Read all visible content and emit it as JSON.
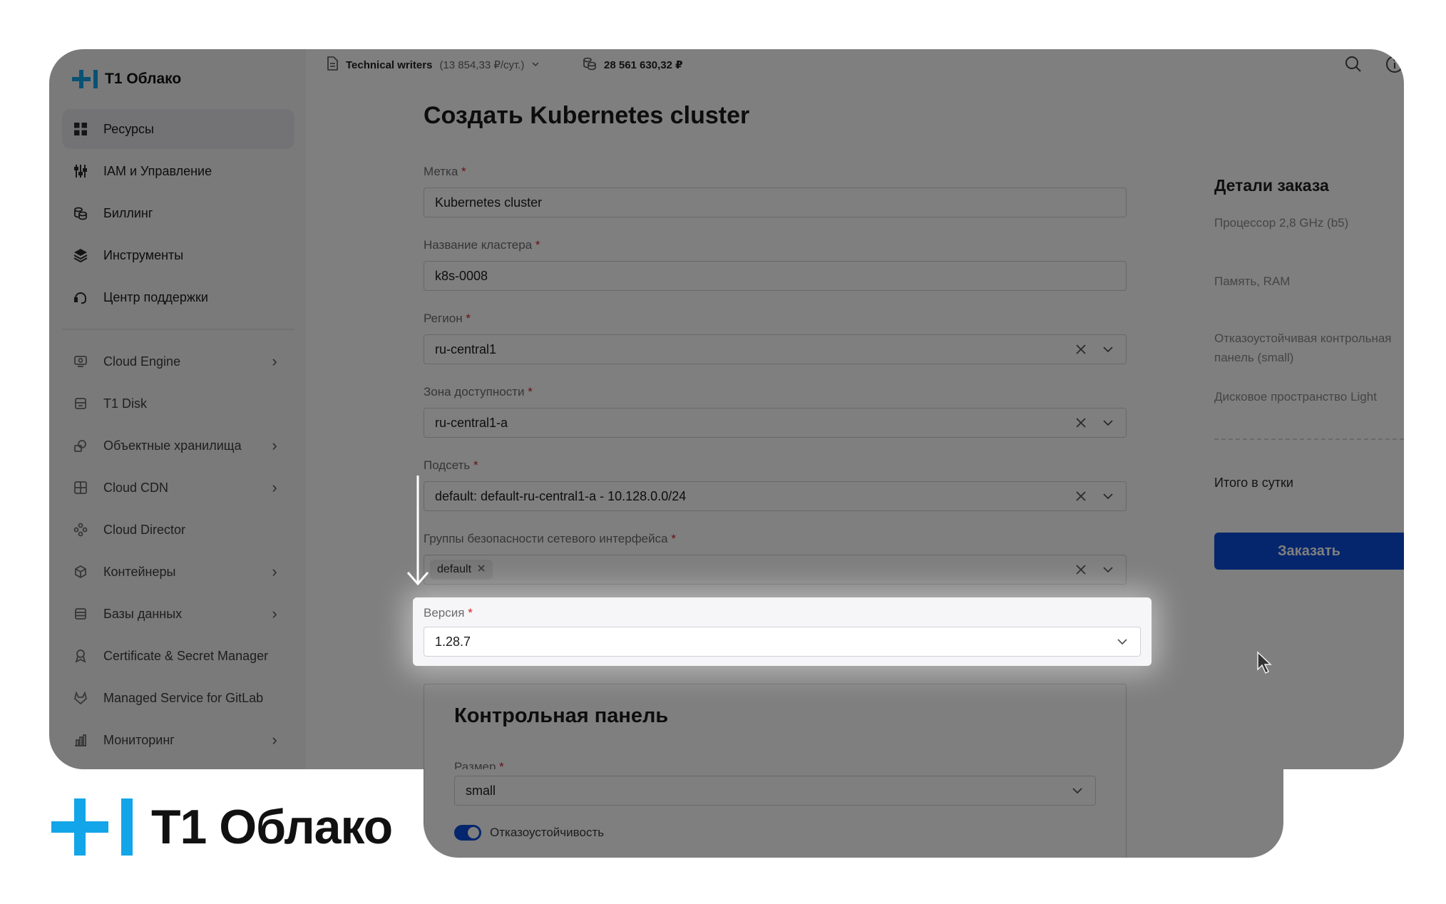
{
  "sidebar": {
    "logo_text": "T1 Облако",
    "items": [
      {
        "label": "Ресурсы",
        "icon": "grid-icon"
      },
      {
        "label": "IAM и Управление",
        "icon": "sliders-icon"
      },
      {
        "label": "Биллинг",
        "icon": "coins-icon"
      },
      {
        "label": "Инструменты",
        "icon": "layers-icon"
      },
      {
        "label": "Центр поддержки",
        "icon": "headset-icon"
      }
    ],
    "services": [
      {
        "label": "Cloud Engine",
        "icon": "monitor-icon",
        "chevron": true
      },
      {
        "label": "T1 Disk",
        "icon": "disk-icon",
        "chevron": false
      },
      {
        "label": "Объектные хранилища",
        "icon": "storage-icon",
        "chevron": true
      },
      {
        "label": "Cloud CDN",
        "icon": "cdn-icon",
        "chevron": true
      },
      {
        "label": "Cloud Director",
        "icon": "director-icon",
        "chevron": false
      },
      {
        "label": "Контейнеры",
        "icon": "container-icon",
        "chevron": true
      },
      {
        "label": "Базы данных",
        "icon": "database-icon",
        "chevron": true
      },
      {
        "label": "Certificate & Secret Manager",
        "icon": "certificate-icon",
        "chevron": false
      },
      {
        "label": "Managed Service for GitLab",
        "icon": "gitlab-icon",
        "chevron": false
      },
      {
        "label": "Мониторинг",
        "icon": "chart-icon",
        "chevron": true
      }
    ]
  },
  "topbar": {
    "project_name": "Technical writers",
    "project_rate": "(13 854,33 ₽/сут.)",
    "balance": "28 561 630,32 ₽"
  },
  "form": {
    "title": "Создать Kubernetes cluster",
    "label_field": {
      "label": "Метка",
      "value": "Kubernetes cluster"
    },
    "cluster_name": {
      "label": "Название кластера",
      "value": "k8s-0008"
    },
    "region": {
      "label": "Регион",
      "value": "ru-central1"
    },
    "zone": {
      "label": "Зона доступности",
      "value": "ru-central1-a"
    },
    "subnet": {
      "label": "Подсеть",
      "value": "default: default-ru-central1-a - 10.128.0.0/24"
    },
    "security_groups": {
      "label": "Группы безопасности сетевого интерфейса",
      "tag": "default"
    },
    "version": {
      "label": "Версия",
      "value": "1.28.7"
    },
    "control_panel": {
      "title": "Контрольная панель",
      "size_label": "Размер",
      "size_value": "small",
      "fault_tolerance_label": "Отказоустойчивость"
    },
    "required_mark": "*"
  },
  "order": {
    "title": "Детали заказа",
    "lines": [
      "Процессор 2,8 GHz (b5)",
      "Память, RAM",
      "Отказоустойчивая контрольная панель (small)",
      "Дисковое пространство Light"
    ],
    "total_label": "Итого в сутки",
    "button_label": "Заказать"
  },
  "brand": {
    "text": "T1 Облако"
  },
  "colors": {
    "accent": "#0b4dd8",
    "brand": "#12a5e8",
    "required": "#d3202a"
  }
}
